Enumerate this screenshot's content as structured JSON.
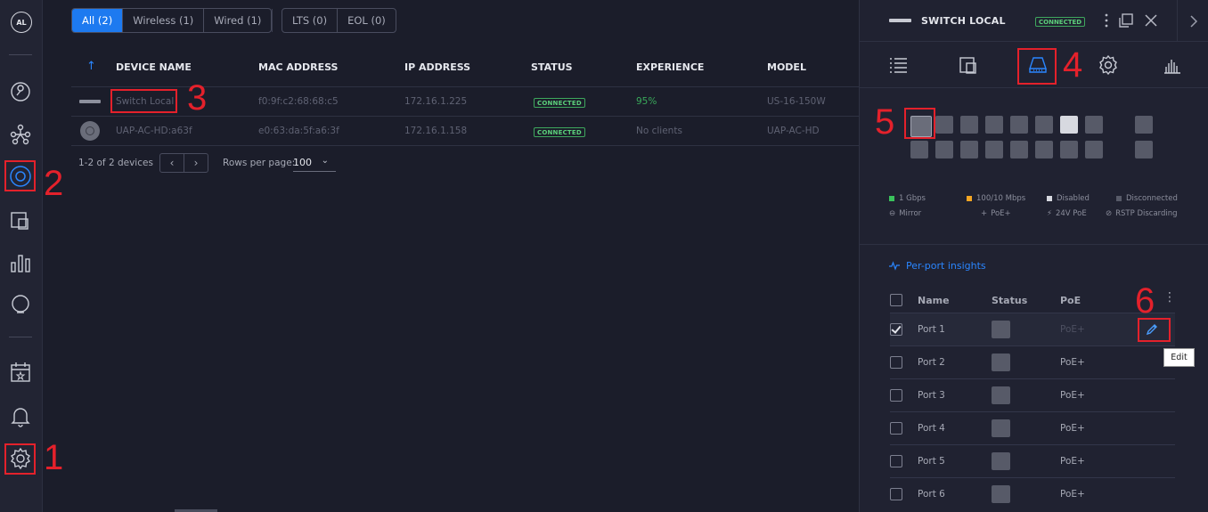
{
  "sidebar": {
    "avatar": "AL",
    "icons": [
      "dashboard-icon",
      "topology-icon",
      "devices-icon",
      "clients-icon",
      "statistics-icon",
      "insights-icon",
      "events-icon",
      "alerts-icon",
      "settings-icon"
    ]
  },
  "filters": {
    "group1": [
      {
        "label": "All (2)",
        "active": true
      },
      {
        "label": "Wireless (1)"
      },
      {
        "label": "Wired (1)"
      }
    ],
    "group2": [
      {
        "label": "LTS (0)"
      },
      {
        "label": "EOL (0)"
      }
    ]
  },
  "table": {
    "columns": [
      "DEVICE NAME",
      "MAC ADDRESS",
      "IP ADDRESS",
      "STATUS",
      "EXPERIENCE",
      "MODEL"
    ],
    "rows": [
      {
        "name": "Switch Local",
        "mac": "f0:9f:c2:68:68:c5",
        "ip": "172.16.1.225",
        "status": "CONNECTED",
        "experience": "95%",
        "model": "US-16-150W"
      },
      {
        "name": "UAP-AC-HD:a63f",
        "mac": "e0:63:da:5f:a6:3f",
        "ip": "172.16.1.158",
        "status": "CONNECTED",
        "experience": "No clients",
        "model": "UAP-AC-HD"
      }
    ]
  },
  "pager": {
    "summary": "1-2 of 2 devices",
    "rows_label": "Rows per page:",
    "rows_value": "100"
  },
  "panel": {
    "title": "SWITCH LOCAL",
    "status": "CONNECTED",
    "legend": [
      "1 Gbps",
      "100/10 Mbps",
      "Disabled",
      "Disconnected",
      "Mirror",
      "PoE+",
      "24V PoE",
      "RSTP Discarding"
    ],
    "legend_colors": {
      "gbps": "#3ac25c",
      "mbps": "#f5a623",
      "disabled": "#d7d9e0",
      "disconnected": "#575a68"
    },
    "insights_label": "Per-port insights",
    "port_columns": {
      "name": "Name",
      "status": "Status",
      "poe": "PoE"
    },
    "ports": [
      {
        "name": "Port 1",
        "poe": "PoE+"
      },
      {
        "name": "Port 2",
        "poe": "PoE+"
      },
      {
        "name": "Port 3",
        "poe": "PoE+"
      },
      {
        "name": "Port 4",
        "poe": "PoE+"
      },
      {
        "name": "Port 5",
        "poe": "PoE+"
      },
      {
        "name": "Port 6",
        "poe": "PoE+"
      }
    ],
    "tooltip": "Edit"
  },
  "annotations": [
    "1",
    "2",
    "3",
    "4",
    "5",
    "6"
  ],
  "accent": "#1d7af0",
  "annotation_color": "#e4212b"
}
